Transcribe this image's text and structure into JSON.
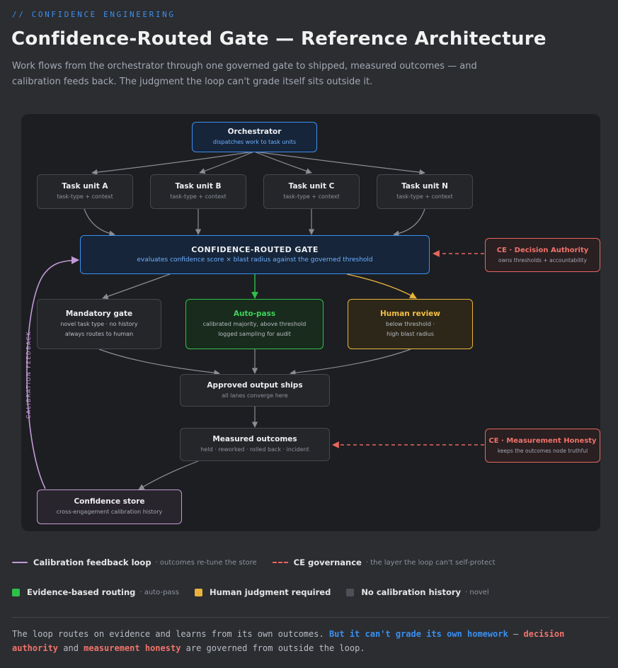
{
  "header": {
    "eyebrow": "// CONFIDENCE ENGINEERING",
    "title": "Confidence-Routed Gate — Reference Architecture",
    "subtitle": "Work flows from the orchestrator through one governed gate to shipped, measured outcomes — and calibration feeds back. The judgment the loop can't grade itself sits outside it."
  },
  "diagram": {
    "orchestrator": {
      "title": "Orchestrator",
      "sub": "dispatches work to task units"
    },
    "tasks": [
      {
        "title": "Task unit A",
        "sub": "task-type + context"
      },
      {
        "title": "Task unit B",
        "sub": "task-type + context"
      },
      {
        "title": "Task unit C",
        "sub": "task-type + context"
      },
      {
        "title": "Task unit N",
        "sub": "task-type + context"
      }
    ],
    "gate": {
      "title": "CONFIDENCE-ROUTED GATE",
      "sub": "evaluates confidence score × blast radius against the governed threshold"
    },
    "ce_decision": {
      "title": "CE · Decision Authority",
      "sub": "owns thresholds + accountability"
    },
    "mandatory": {
      "title": "Mandatory gate",
      "line1": "novel task type · no history",
      "line2": "always routes to human"
    },
    "auto": {
      "title": "Auto-pass",
      "line1": "calibrated majority, above threshold",
      "line2": "logged sampling for audit"
    },
    "human": {
      "title": "Human review",
      "line1": "below threshold ·",
      "line2": "high blast radius"
    },
    "approved": {
      "title": "Approved output ships",
      "sub": "all lanes converge here"
    },
    "measured": {
      "title": "Measured outcomes",
      "sub": "held · reworked · rolled back · incident"
    },
    "ce_measure": {
      "title": "CE · Measurement Honesty",
      "sub": "keeps the outcomes node truthful"
    },
    "store": {
      "title": "Confidence store",
      "sub": "cross-engagement calibration history"
    },
    "feedback_label": "CALIBRATION FEEDBACK"
  },
  "legend": {
    "row1": [
      {
        "label": "Calibration feedback loop",
        "note": "· outcomes re-tune the store"
      },
      {
        "label": "CE governance",
        "note": "· the layer the loop can't self-protect"
      }
    ],
    "row2": [
      {
        "label": "Evidence-based routing",
        "note": "· auto-pass"
      },
      {
        "label": "Human judgment required",
        "note": ""
      },
      {
        "label": "No calibration history",
        "note": "· novel"
      }
    ]
  },
  "footer": {
    "p1": "The loop routes on evidence and learns from its own outcomes. ",
    "p2": "But it can't grade its own homework",
    "p3": " — ",
    "p4": "decision authority",
    "p5": " and ",
    "p6": "measurement honesty",
    "p7": " are governed from outside the loop."
  },
  "colors": {
    "accent_blue": "#3b8ff0",
    "green": "#2fc04a",
    "amber": "#e8b33c",
    "red": "#e8665f",
    "purple": "#c39ad8",
    "gray": "#45474d"
  }
}
